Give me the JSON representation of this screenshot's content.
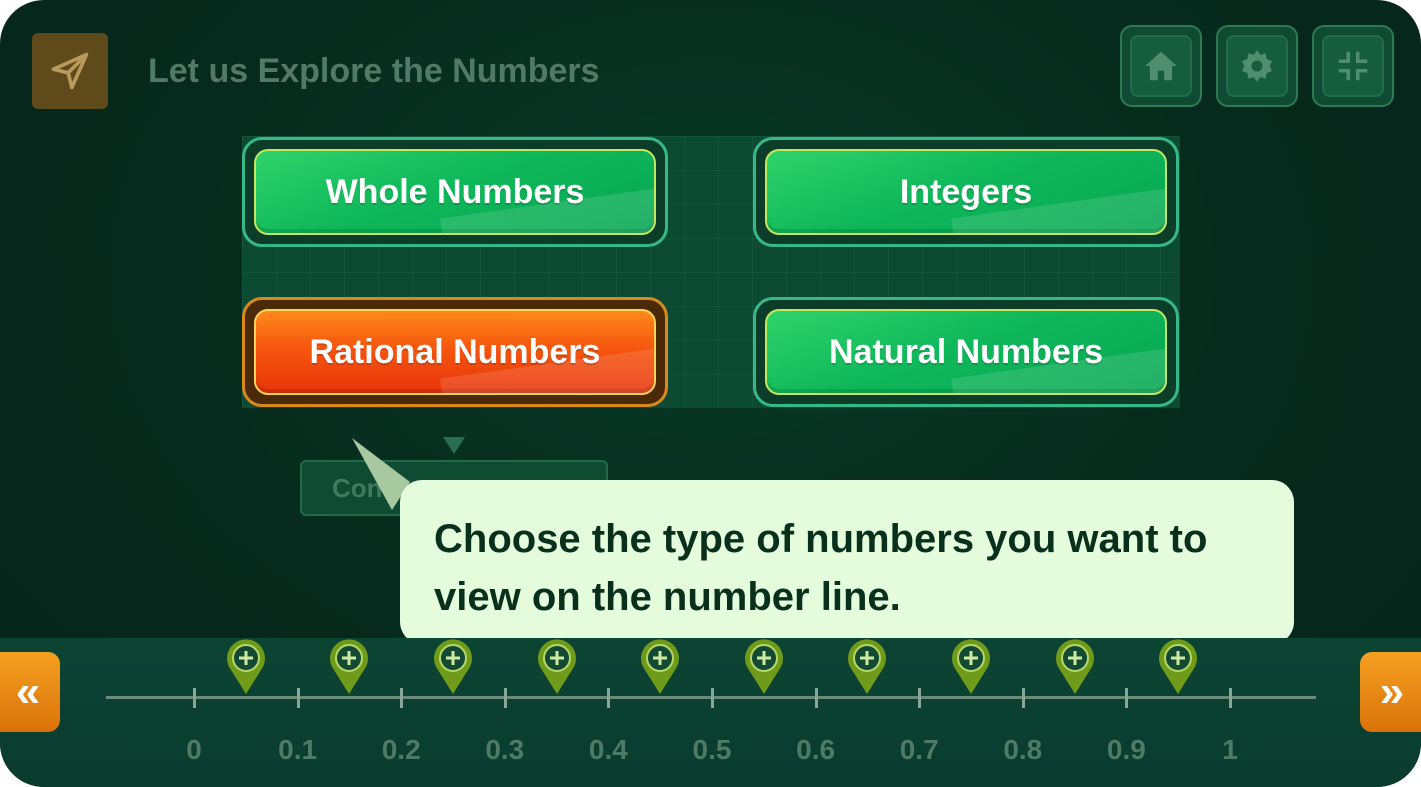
{
  "header": {
    "title": "Let us Explore the Numbers",
    "app_icon": "paper-plane-icon",
    "buttons": [
      {
        "name": "home-button",
        "icon": "home-icon"
      },
      {
        "name": "settings-button",
        "icon": "gear-icon"
      },
      {
        "name": "fullscreen-exit-button",
        "icon": "compress-icon"
      }
    ]
  },
  "choices": {
    "whole": "Whole Numbers",
    "integers": "Integers",
    "rational": "Rational Numbers",
    "natural": "Natural Numbers",
    "selected": "Rational Numbers"
  },
  "convert_button": {
    "visible_text": "Conve"
  },
  "tooltip": {
    "text": "Choose the type of numbers you want to view on the number line."
  },
  "number_line": {
    "ticks": [
      "0",
      "0.1",
      "0.2",
      "0.3",
      "0.4",
      "0.5",
      "0.6",
      "0.7",
      "0.8",
      "0.9",
      "1"
    ],
    "markers": 10,
    "marker_icon": "plus-pin-icon",
    "prev_icon": "double-chevron-left-icon",
    "next_icon": "double-chevron-right-icon"
  },
  "colors": {
    "background": "#062a1d",
    "choice_green": "#0fb85a",
    "choice_selected": "#f5560f",
    "tooltip_bg": "#e4fbdc",
    "nav_orange": "#f5a020"
  }
}
